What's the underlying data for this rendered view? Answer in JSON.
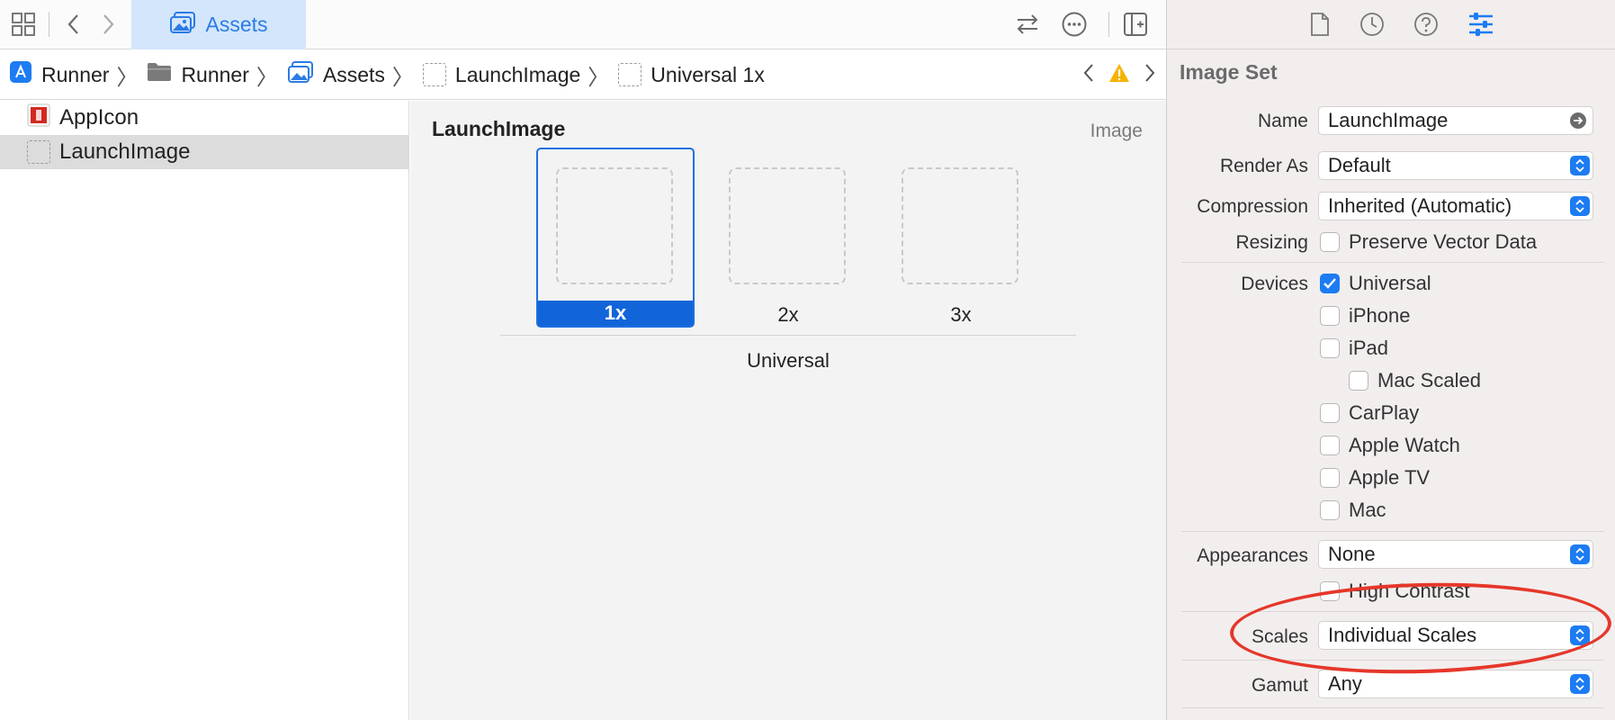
{
  "tabbar": {
    "active_tab_label": "Assets",
    "icons": [
      "grid-icon",
      "chevron-left-icon",
      "chevron-right-icon",
      "swap-icon",
      "more-icon",
      "add-editor-icon"
    ]
  },
  "jumpbar": {
    "crumbs": [
      {
        "label": "Runner",
        "icon": "app-icon"
      },
      {
        "label": "Runner",
        "icon": "folder-icon"
      },
      {
        "label": "Assets",
        "icon": "assets-icon"
      },
      {
        "label": "LaunchImage",
        "icon": "placeholder-icon"
      },
      {
        "label": "Universal 1x",
        "icon": "placeholder-icon"
      }
    ],
    "warning_icon": "warning-icon"
  },
  "outline": {
    "items": [
      {
        "label": "AppIcon",
        "selected": false
      },
      {
        "label": "LaunchImage",
        "selected": true
      }
    ]
  },
  "canvas": {
    "title": "LaunchImage",
    "kind": "Image",
    "slots": [
      {
        "label": "1x",
        "selected": true
      },
      {
        "label": "2x",
        "selected": false
      },
      {
        "label": "3x",
        "selected": false
      }
    ],
    "group_label": "Universal"
  },
  "inspector": {
    "title": "Image Set",
    "name_label": "Name",
    "name_value": "LaunchImage",
    "render_as_label": "Render As",
    "render_as_value": "Default",
    "compression_label": "Compression",
    "compression_value": "Inherited (Automatic)",
    "resizing_label": "Resizing",
    "preserve_vector_label": "Preserve Vector Data",
    "devices_label": "Devices",
    "devices": {
      "universal": "Universal",
      "iphone": "iPhone",
      "ipad": "iPad",
      "mac_scaled": "Mac Scaled",
      "carplay": "CarPlay",
      "apple_watch": "Apple Watch",
      "apple_tv": "Apple TV",
      "mac": "Mac"
    },
    "appearances_label": "Appearances",
    "appearances_value": "None",
    "high_contrast_label": "High Contrast",
    "scales_label": "Scales",
    "scales_value": "Individual Scales",
    "gamut_label": "Gamut",
    "gamut_value": "Any"
  },
  "colors": {
    "accent": "#1d7cf2",
    "annotation": "#e5372a"
  }
}
